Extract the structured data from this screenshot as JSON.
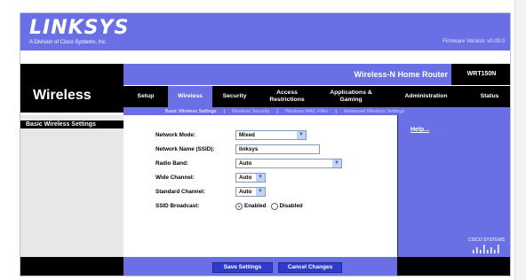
{
  "brand": {
    "logo": "LINKSYS",
    "subtitle": "A Division of Cisco Systems, Inc.",
    "firmware": "Firmware Version: v0.00.0"
  },
  "product": {
    "name": "Wireless-N Home Router",
    "model": "WRT150N"
  },
  "section_title": "Wireless",
  "tabs": [
    {
      "label": "Setup"
    },
    {
      "label": "Wireless"
    },
    {
      "label": "Security"
    },
    {
      "label": "Access Restrictions"
    },
    {
      "label": "Applications & Gaming"
    },
    {
      "label": "Administration"
    },
    {
      "label": "Status"
    }
  ],
  "active_tab": "Wireless",
  "subtabs": [
    {
      "label": "Basic Wireless Settings"
    },
    {
      "label": "Wireless Security"
    },
    {
      "label": "Wireless MAC Filter"
    },
    {
      "label": "Advanced Wireless Settings"
    }
  ],
  "left_heading": "Basic Wireless Settings",
  "form": {
    "network_mode": {
      "label": "Network Mode:",
      "value": "Mixed"
    },
    "ssid": {
      "label": "Network Name (SSID):",
      "value": "linksys"
    },
    "radio_band": {
      "label": "Radio Band:",
      "value": "Auto"
    },
    "wide_channel": {
      "label": "Wide Channel:",
      "value": "Auto"
    },
    "standard_channel": {
      "label": "Standard Channel:",
      "value": "Auto"
    },
    "ssid_broadcast": {
      "label": "SSID Broadcast:",
      "enabled": "Enabled",
      "disabled": "Disabled",
      "selected": "Enabled"
    }
  },
  "help_link": "Help...",
  "cisco_logo": "CISCO SYSTEMS",
  "buttons": {
    "save": "Save Settings",
    "cancel": "Cancel Changes"
  },
  "colors": {
    "accent": "#6a6fe6",
    "dark": "#000000",
    "button": "#2e3cc9"
  }
}
